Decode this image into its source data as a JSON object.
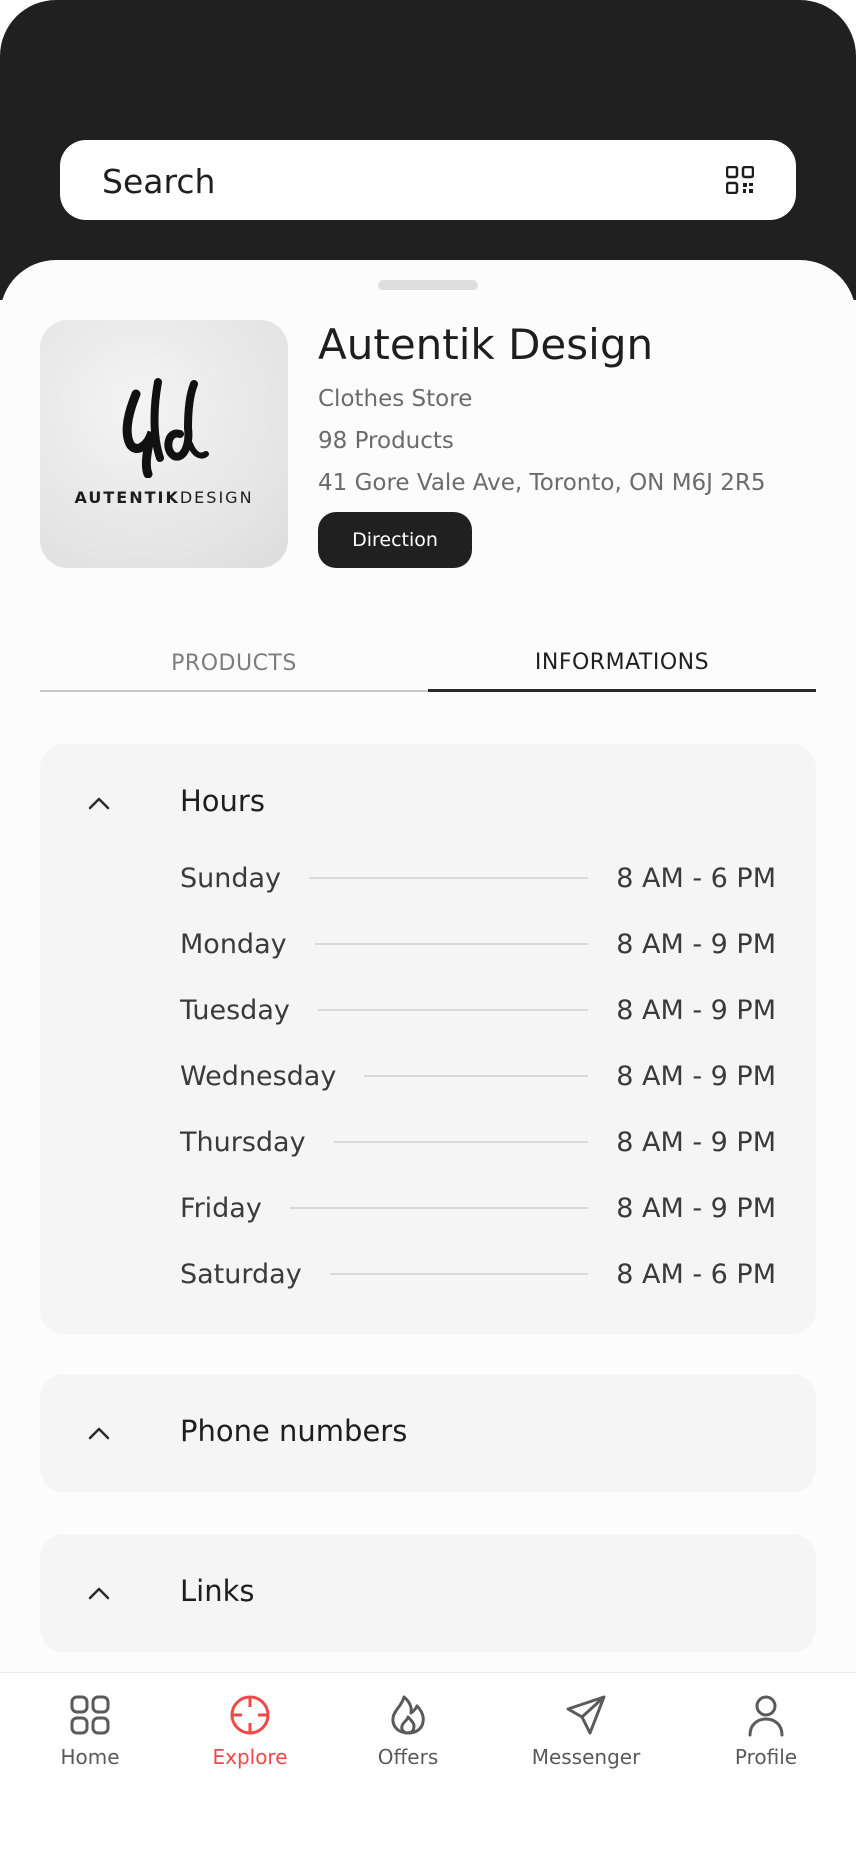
{
  "search": {
    "placeholder": "Search"
  },
  "store": {
    "logo_text_bold": "AUTENTIK",
    "logo_text_light": "DESIGN",
    "name": "Autentik Design",
    "category": "Clothes Store",
    "products_count": "98 Products",
    "address": "41 Gore Vale Ave, Toronto, ON M6J 2R5",
    "direction_label": "Direction"
  },
  "tabs": [
    {
      "label": "PRODUCTS",
      "active": false
    },
    {
      "label": "INFORMATIONS",
      "active": true
    }
  ],
  "hours": {
    "title": "Hours",
    "rows": [
      {
        "day": "Sunday",
        "time": "8 AM - 6 PM"
      },
      {
        "day": "Monday",
        "time": "8 AM - 9 PM"
      },
      {
        "day": "Tuesday",
        "time": "8 AM - 9 PM"
      },
      {
        "day": "Wednesday",
        "time": "8 AM - 9 PM"
      },
      {
        "day": "Thursday",
        "time": "8 AM - 9 PM"
      },
      {
        "day": "Friday",
        "time": "8 AM - 9 PM"
      },
      {
        "day": "Saturday",
        "time": "8 AM - 6 PM"
      }
    ]
  },
  "phone_numbers": {
    "title": "Phone numbers"
  },
  "links": {
    "title": "Links"
  },
  "nav": [
    {
      "label": "Home",
      "icon": "home-grid-icon",
      "active": false
    },
    {
      "label": "Explore",
      "icon": "crosshair-icon",
      "active": true
    },
    {
      "label": "Offers",
      "icon": "flame-icon",
      "active": false
    },
    {
      "label": "Messenger",
      "icon": "paper-plane-icon",
      "active": false
    },
    {
      "label": "Profile",
      "icon": "user-icon",
      "active": false
    }
  ],
  "colors": {
    "accent": "#f04848",
    "dark": "#202021",
    "card": "#f5f5f5"
  }
}
